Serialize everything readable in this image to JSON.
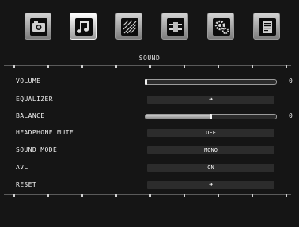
{
  "menu": {
    "title": "SOUND",
    "tabs": [
      {
        "name": "picture-icon",
        "active": false
      },
      {
        "name": "sound-icon",
        "active": true
      },
      {
        "name": "channel-icon",
        "active": false
      },
      {
        "name": "source-icon",
        "active": false
      },
      {
        "name": "setup-icon",
        "active": false
      },
      {
        "name": "info-icon",
        "active": false
      }
    ],
    "rows": [
      {
        "label": "VOLUME",
        "type": "slider",
        "level": 0,
        "value": "0"
      },
      {
        "label": "EQUALIZER",
        "type": "submenu",
        "arrow": "➜"
      },
      {
        "label": "BALANCE",
        "type": "slider",
        "level": 0.5,
        "value": "0"
      },
      {
        "label": "HEADPHONE MUTE",
        "type": "option",
        "value": "OFF"
      },
      {
        "label": "SOUND MODE",
        "type": "option",
        "value": "MONO"
      },
      {
        "label": "AVL",
        "type": "option",
        "value": "ON"
      },
      {
        "label": "RESET",
        "type": "submenu",
        "arrow": "➜"
      }
    ]
  },
  "colors": {
    "background": "#151515",
    "field": "#2c2c2c",
    "text": "#f0f0f0"
  }
}
